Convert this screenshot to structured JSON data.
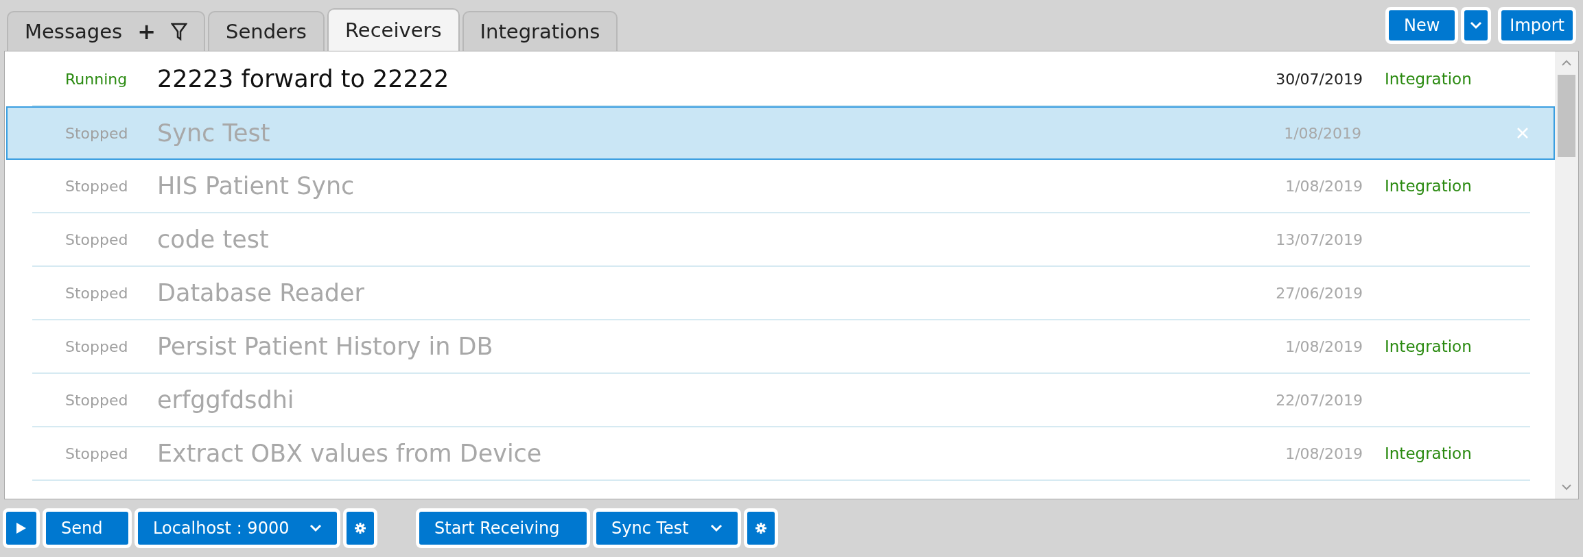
{
  "tabs": [
    {
      "label": "Messages",
      "selected": false,
      "kind": "messages",
      "add_icon": "+"
    },
    {
      "label": "Senders",
      "selected": false,
      "kind": "plain"
    },
    {
      "label": "Receivers",
      "selected": true,
      "kind": "plain"
    },
    {
      "label": "Integrations",
      "selected": false,
      "kind": "plain"
    }
  ],
  "toolbar": {
    "new_button": "New",
    "import_button": "Import"
  },
  "rows": [
    {
      "status": "Running",
      "running": true,
      "name": "22223 forward to 22222",
      "date": "30/07/2019",
      "tag": "Integration",
      "selected": false
    },
    {
      "status": "Stopped",
      "running": false,
      "name": "Sync Test",
      "date": "1/08/2019",
      "selected": true
    },
    {
      "status": "Stopped",
      "running": false,
      "name": "HIS Patient Sync",
      "date": "1/08/2019",
      "tag": "Integration",
      "selected": false
    },
    {
      "status": "Stopped",
      "running": false,
      "name": "code test",
      "date": "13/07/2019",
      "selected": false
    },
    {
      "status": "Stopped",
      "running": false,
      "name": "Database Reader",
      "date": "27/06/2019",
      "selected": false
    },
    {
      "status": "Stopped",
      "running": false,
      "name": "Persist Patient History in DB",
      "date": "1/08/2019",
      "tag": "Integration",
      "selected": false
    },
    {
      "status": "Stopped",
      "running": false,
      "name": "erfggfdsdhi",
      "date": "22/07/2019",
      "selected": false
    },
    {
      "status": "Stopped",
      "running": false,
      "name": "Extract OBX values from Device",
      "date": "1/08/2019",
      "tag": "Integration",
      "selected": false
    }
  ],
  "bottom_bar": {
    "send_button": "Send",
    "sender_select": "Localhost : 9000",
    "receive_button": "Start Receiving",
    "receiver_select": "Sync Test"
  }
}
